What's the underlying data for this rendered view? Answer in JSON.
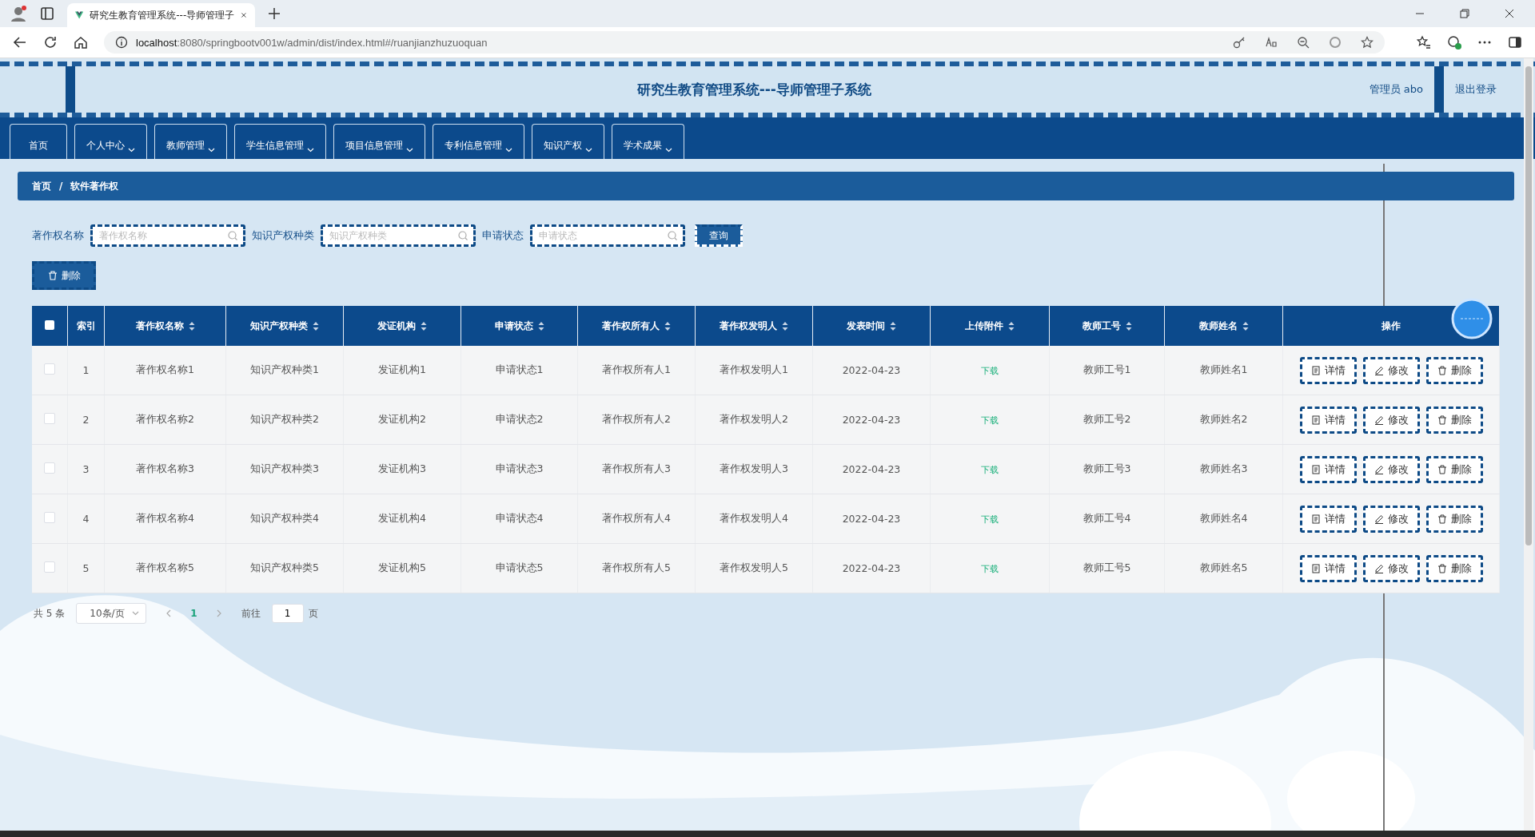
{
  "browser": {
    "tab_title": "研究生教育管理系统---导师管理子",
    "url_host": "localhost",
    "url_rest": ":8080/springbootv001w/admin/dist/index.html#/ruanjianzhuzuoquan"
  },
  "header": {
    "title": "研究生教育管理系统---导师管理子系统",
    "user": "管理员 abo",
    "logout": "退出登录"
  },
  "nav": [
    {
      "label": "首页",
      "has_dropdown": false
    },
    {
      "label": "个人中心",
      "has_dropdown": true
    },
    {
      "label": "教师管理",
      "has_dropdown": true
    },
    {
      "label": "学生信息管理",
      "has_dropdown": true
    },
    {
      "label": "项目信息管理",
      "has_dropdown": true
    },
    {
      "label": "专利信息管理",
      "has_dropdown": true
    },
    {
      "label": "知识产权",
      "has_dropdown": true
    },
    {
      "label": "学术成果",
      "has_dropdown": true
    }
  ],
  "breadcrumb": {
    "items": [
      "首页",
      "软件著作权"
    ],
    "separator": "/"
  },
  "search": {
    "fields": [
      {
        "label": "著作权名称",
        "placeholder": "著作权名称"
      },
      {
        "label": "知识产权种类",
        "placeholder": "知识产权种类"
      },
      {
        "label": "申请状态",
        "placeholder": "申请状态"
      }
    ],
    "button": "查询"
  },
  "delete_button": "删除",
  "table": {
    "header_checked": false,
    "columns": [
      {
        "label": "索引",
        "sortable": false,
        "kind": "text"
      },
      {
        "label": "著作权名称",
        "sortable": true,
        "kind": "text"
      },
      {
        "label": "知识产权种类",
        "sortable": true,
        "kind": "text"
      },
      {
        "label": "发证机构",
        "sortable": true,
        "kind": "text"
      },
      {
        "label": "申请状态",
        "sortable": true,
        "kind": "text"
      },
      {
        "label": "著作权所有人",
        "sortable": true,
        "kind": "text"
      },
      {
        "label": "著作权发明人",
        "sortable": true,
        "kind": "text"
      },
      {
        "label": "发表时间",
        "sortable": true,
        "kind": "text"
      },
      {
        "label": "上传附件",
        "sortable": true,
        "kind": "link"
      },
      {
        "label": "教师工号",
        "sortable": true,
        "kind": "text"
      },
      {
        "label": "教师姓名",
        "sortable": true,
        "kind": "text"
      },
      {
        "label": "操作",
        "sortable": false,
        "kind": "actions"
      }
    ],
    "rows": [
      {
        "checked": false,
        "cells": [
          "1",
          "著作权名称1",
          "知识产权种类1",
          "发证机构1",
          "申请状态1",
          "著作权所有人1",
          "著作权发明人1",
          "2022-04-23",
          "下载",
          "教师工号1",
          "教师姓名1"
        ],
        "actions": [
          {
            "kind": "detail",
            "label": "详情"
          },
          {
            "kind": "edit",
            "label": "修改"
          },
          {
            "kind": "delete",
            "label": "删除"
          }
        ]
      },
      {
        "checked": false,
        "cells": [
          "2",
          "著作权名称2",
          "知识产权种类2",
          "发证机构2",
          "申请状态2",
          "著作权所有人2",
          "著作权发明人2",
          "2022-04-23",
          "下载",
          "教师工号2",
          "教师姓名2"
        ],
        "actions": [
          {
            "kind": "detail",
            "label": "详情"
          },
          {
            "kind": "edit",
            "label": "修改"
          },
          {
            "kind": "delete",
            "label": "删除"
          }
        ]
      },
      {
        "checked": false,
        "cells": [
          "3",
          "著作权名称3",
          "知识产权种类3",
          "发证机构3",
          "申请状态3",
          "著作权所有人3",
          "著作权发明人3",
          "2022-04-23",
          "下载",
          "教师工号3",
          "教师姓名3"
        ],
        "actions": [
          {
            "kind": "detail",
            "label": "详情"
          },
          {
            "kind": "edit",
            "label": "修改"
          },
          {
            "kind": "delete",
            "label": "删除"
          }
        ]
      },
      {
        "checked": false,
        "cells": [
          "4",
          "著作权名称4",
          "知识产权种类4",
          "发证机构4",
          "申请状态4",
          "著作权所有人4",
          "著作权发明人4",
          "2022-04-23",
          "下载",
          "教师工号4",
          "教师姓名4"
        ],
        "actions": [
          {
            "kind": "detail",
            "label": "详情"
          },
          {
            "kind": "edit",
            "label": "修改"
          },
          {
            "kind": "delete",
            "label": "删除"
          }
        ]
      },
      {
        "checked": false,
        "cells": [
          "5",
          "著作权名称5",
          "知识产权种类5",
          "发证机构5",
          "申请状态5",
          "著作权所有人5",
          "著作权发明人5",
          "2022-04-23",
          "下载",
          "教师工号5",
          "教师姓名5"
        ],
        "actions": [
          {
            "kind": "detail",
            "label": "详情"
          },
          {
            "kind": "edit",
            "label": "修改"
          },
          {
            "kind": "delete",
            "label": "删除"
          }
        ]
      }
    ]
  },
  "pagination": {
    "total": "共 5 条",
    "page_size": "10条/页",
    "pages": [
      {
        "label": "1",
        "selected": true
      }
    ],
    "goto_label": "前往",
    "goto_value": "1",
    "goto_unit": "页"
  }
}
